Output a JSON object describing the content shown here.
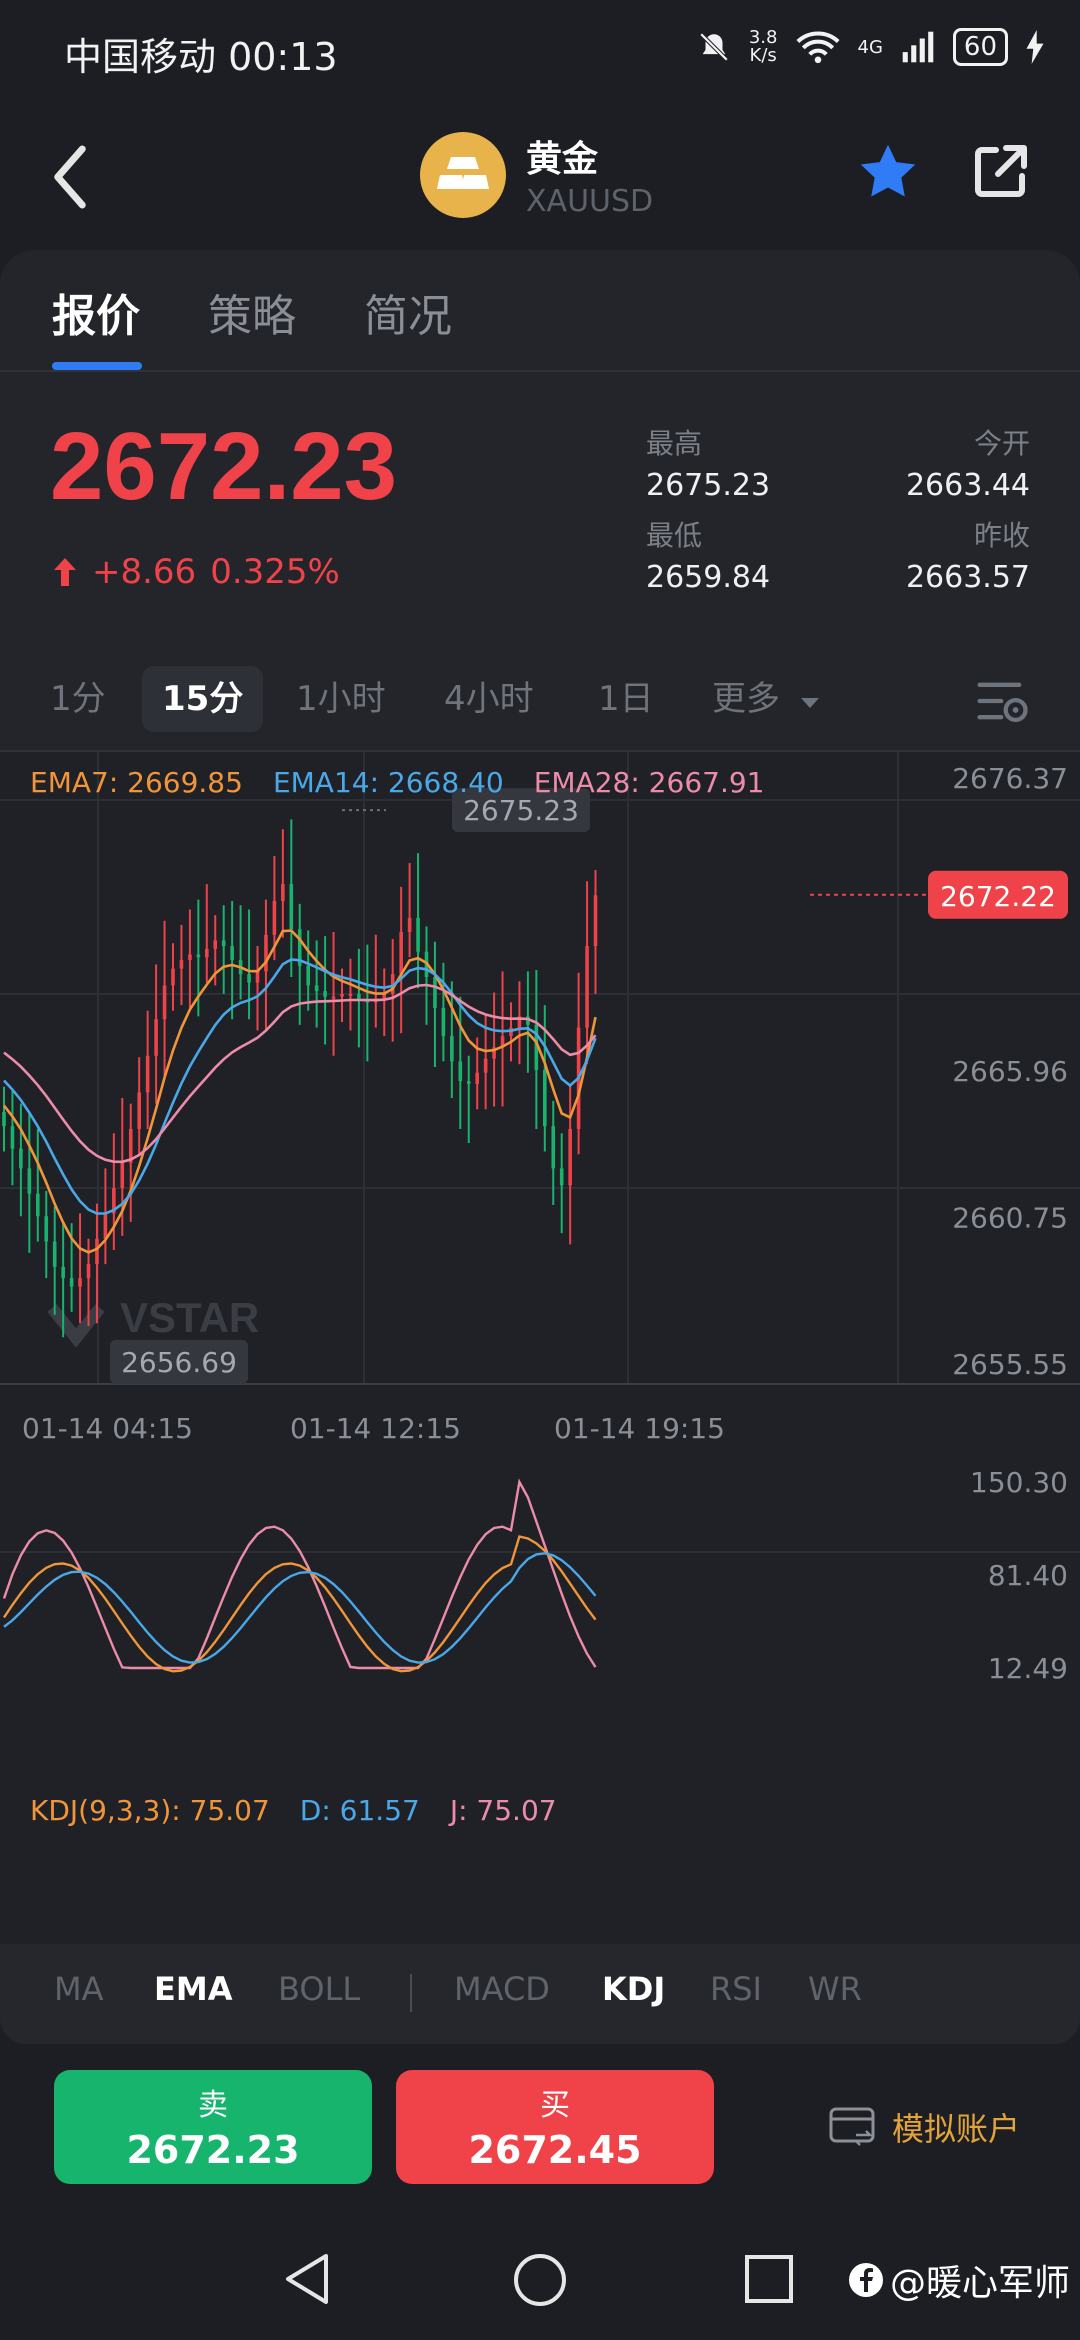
{
  "status": {
    "carrier_time": "中国移动 00:13",
    "net_speed_value": "3.8",
    "net_speed_unit": "K/s",
    "signal": "4G",
    "battery": "60"
  },
  "header": {
    "title": "黄金",
    "symbol": "XAUUSD"
  },
  "tabs": [
    {
      "label": "报价"
    },
    {
      "label": "策略"
    },
    {
      "label": "简况"
    }
  ],
  "quote": {
    "price": "2672.23",
    "change": "+8.66",
    "change_pct": "0.325%",
    "high_label": "最高",
    "high": "2675.23",
    "open_label": "今开",
    "open": "2663.44",
    "low_label": "最低",
    "low": "2659.84",
    "prev_close_label": "昨收",
    "prev_close": "2663.57"
  },
  "periods": [
    {
      "label": "1分"
    },
    {
      "label": "15分"
    },
    {
      "label": "1小时"
    },
    {
      "label": "4小时"
    },
    {
      "label": "1日"
    },
    {
      "label": "更多"
    }
  ],
  "ema_legend": {
    "ema7": "EMA7: 2669.85",
    "ema14": "EMA14: 2668.40",
    "ema28": "EMA28: 2667.91"
  },
  "kdj_legend": {
    "k": "KDJ(9,3,3): 75.07",
    "d": "D: 61.57",
    "j": "J: 75.07"
  },
  "colors": {
    "up": "#ef4249",
    "down": "#16b46c",
    "ema7": "#f0953a",
    "ema14": "#4aa8e8",
    "ema28": "#ec8ca8",
    "accent": "#2f7cf6"
  },
  "chart_data": [
    {
      "type": "candlestick",
      "title": "",
      "y_ticks": [
        "2676.37",
        "2665.96",
        "2660.75",
        "2655.55"
      ],
      "x_ticks": [
        "01-14 04:15",
        "01-14 12:15",
        "01-14 19:15"
      ],
      "ylim": [
        2655.55,
        2676.37
      ],
      "high_marker": "2675.23",
      "low_marker": "2656.69",
      "last_price_tag": "2672.22",
      "watermark": "VSTAR",
      "series": [
        {
          "name": "EMA7",
          "last": 2669.85
        },
        {
          "name": "EMA14",
          "last": 2668.4
        },
        {
          "name": "EMA28",
          "last": 2667.91
        }
      ]
    },
    {
      "type": "line",
      "title": "",
      "y_ticks": [
        "150.30",
        "81.40",
        "12.49"
      ],
      "ylim": [
        12.49,
        150.3
      ],
      "series": [
        {
          "name": "K",
          "last": 75.07
        },
        {
          "name": "D",
          "last": 61.57
        },
        {
          "name": "J",
          "last": 75.07
        }
      ]
    }
  ],
  "indicators": {
    "main": [
      {
        "label": "MA"
      },
      {
        "label": "EMA"
      },
      {
        "label": "BOLL"
      }
    ],
    "sub": [
      {
        "label": "MACD"
      },
      {
        "label": "KDJ"
      },
      {
        "label": "RSI"
      },
      {
        "label": "WR"
      }
    ]
  },
  "trade": {
    "sell_label": "卖",
    "sell_price": "2672.23",
    "buy_label": "买",
    "buy_price": "2672.45",
    "demo_account": "模拟账户"
  },
  "footer": {
    "credit": "@暖心军师"
  }
}
